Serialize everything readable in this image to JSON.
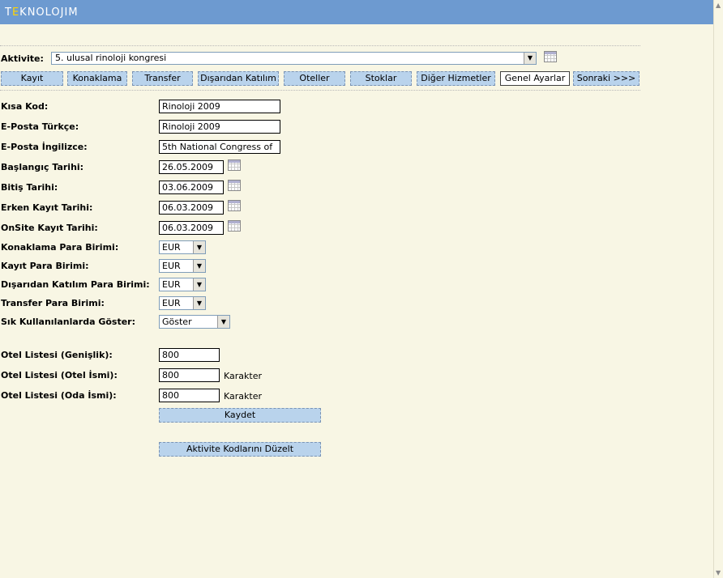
{
  "brand": {
    "logo_prefix": "T",
    "logo_accent": "E",
    "logo_rest": "KNOLOJIM"
  },
  "activity": {
    "label": "Aktivite:",
    "selected": "5. ulusal rinoloji kongresi"
  },
  "tabs": [
    {
      "label": "Kayıt"
    },
    {
      "label": "Konaklama"
    },
    {
      "label": "Transfer"
    },
    {
      "label": "Dışarıdan Katılım"
    },
    {
      "label": "Oteller"
    },
    {
      "label": "Stoklar"
    },
    {
      "label": "Diğer Hizmetler"
    },
    {
      "label": "Genel Ayarlar"
    },
    {
      "label": "Sonraki >>>"
    }
  ],
  "form": {
    "short_code": {
      "label": "Kısa Kod:",
      "value": "Rinoloji 2009"
    },
    "email_tr": {
      "label": "E-Posta Türkçe:",
      "value": "Rinoloji 2009"
    },
    "email_en": {
      "label": "E-Posta İngilizce:",
      "value": "5th National Congress of"
    },
    "start_date": {
      "label": "Başlangıç Tarihi:",
      "value": "26.05.2009"
    },
    "end_date": {
      "label": "Bitiş Tarihi:",
      "value": "03.06.2009"
    },
    "early_reg_date": {
      "label": "Erken Kayıt Tarihi:",
      "value": "06.03.2009"
    },
    "onsite_reg_date": {
      "label": "OnSite Kayıt Tarihi:",
      "value": "06.03.2009"
    },
    "accommodation_currency": {
      "label": "Konaklama Para Birimi:",
      "value": "EUR"
    },
    "registration_currency": {
      "label": "Kayıt Para Birimi:",
      "value": "EUR"
    },
    "external_currency": {
      "label": "Dışarıdan Katılım Para Birimi:",
      "value": "EUR"
    },
    "transfer_currency": {
      "label": "Transfer Para Birimi:",
      "value": "EUR"
    },
    "show_frequent": {
      "label": "Sık Kullanılanlarda Göster:",
      "value": "Göster"
    },
    "hotel_list_width": {
      "label": "Otel Listesi (Genişlik):",
      "value": "800"
    },
    "hotel_list_hotel_name": {
      "label": "Otel Listesi (Otel İsmi):",
      "value": "800",
      "unit": "Karakter"
    },
    "hotel_list_room_name": {
      "label": "Otel Listesi (Oda İsmi):",
      "value": "800",
      "unit": "Karakter"
    }
  },
  "buttons": {
    "save": "Kaydet",
    "edit_codes": "Aktivite Kodlarını Düzelt"
  }
}
